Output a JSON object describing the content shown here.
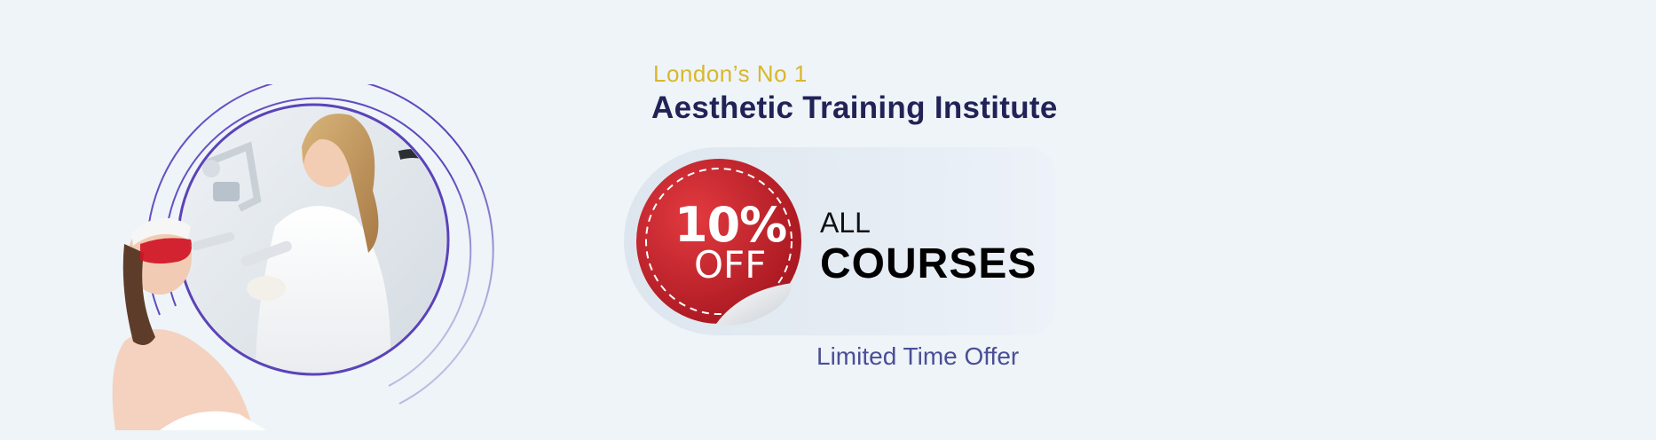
{
  "promo": {
    "tagline": "London’s No 1",
    "headline": "Aesthetic Training Institute",
    "badge": {
      "percent": "10%",
      "off": "OFF"
    },
    "offer_line1": "ALL",
    "offer_line2": "COURSES",
    "footer": "Limited Time Offer"
  },
  "colors": {
    "background": "#eef4f8",
    "tagline": "#d9b72c",
    "headline": "#232257",
    "badge_red": "#c5202b",
    "ring_purple": "#5b43b8",
    "limited": "#4b4e96"
  },
  "image": {
    "subject": "laser-treatment-photo-icon"
  }
}
